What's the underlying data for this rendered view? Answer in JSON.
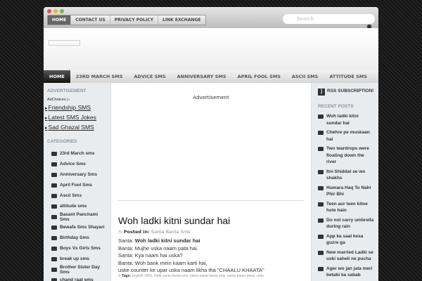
{
  "top_nav": [
    "HOME",
    "CONTACT US",
    "PRIVACY POLICY",
    "LINK EXCHANGE"
  ],
  "search_placeholder": "Search",
  "main_nav": [
    "HOME",
    "23RD MARCH SMS",
    "ADVICE SMS",
    "ANNIVERSARY SMS",
    "APRIL FOOL SMS",
    "ASCII SMS",
    "ATTITUDE SMS"
  ],
  "left": {
    "ad_heading": "ADVERTISEMENT",
    "adchoices": "AdChoices ▷",
    "ad_links": [
      "Friendship SMS",
      "Latest SMS Jokes",
      "Sad Ghazal SMS"
    ],
    "cat_heading": "CATEGORIES",
    "categories": [
      "23rd March sms",
      "Advice Sms",
      "Anniversary Sms",
      "April Fool Sms",
      "Ascii Sms",
      "attitude sms",
      "Basant Panchami Sms",
      "Bewafa Sms Shayari",
      "Birthday Sms",
      "Boys Vs Girls Sms",
      "break up sms",
      "Brother Sister Day Sms",
      "chand raat sms"
    ]
  },
  "main": {
    "advertisement": "Advertisement",
    "title": "Woh ladki kitni sundar hai",
    "posted_label": "Posted in:",
    "posted_cat": "Santa Banta Sms",
    "lines": [
      [
        "Santa: ",
        "Woh ladki kitni sundar hai"
      ],
      [
        "Banta: Mujhe uska naam pata hai.",
        ""
      ],
      [
        "Santa: Kya naam hai uska?",
        ""
      ],
      [
        "Banta: Woh bank mein kaam karti hai,",
        ""
      ],
      [
        "uske counter ke upar uska naam likha tha \"CHAALU KHAATA\"",
        ""
      ]
    ],
    "tags_label": "Tags:",
    "tags": "English SMS, hindi santa banta sms, latest santa banta sms, santa banta jokes, urdu"
  },
  "right": {
    "rss": "RSS SUBSCRIPTION!",
    "recent_heading": "RECENT POSTS",
    "posts": [
      "Woh ladki kitni sundar hai",
      "Chehre pe muskaan hai",
      "Two teardrops were floating down the river",
      "Itni Shiddat se wo shakhs",
      "Humara Haq To Nahi Phir Bhi",
      "Teen aur teen kitne hote hain",
      "Do not carry umbrella during rain",
      "App ka saal kesa guzre ga",
      "New married Ladki se uski saheli ne pucha",
      "Ager wo jan jata meri betabi ka sabab"
    ]
  }
}
